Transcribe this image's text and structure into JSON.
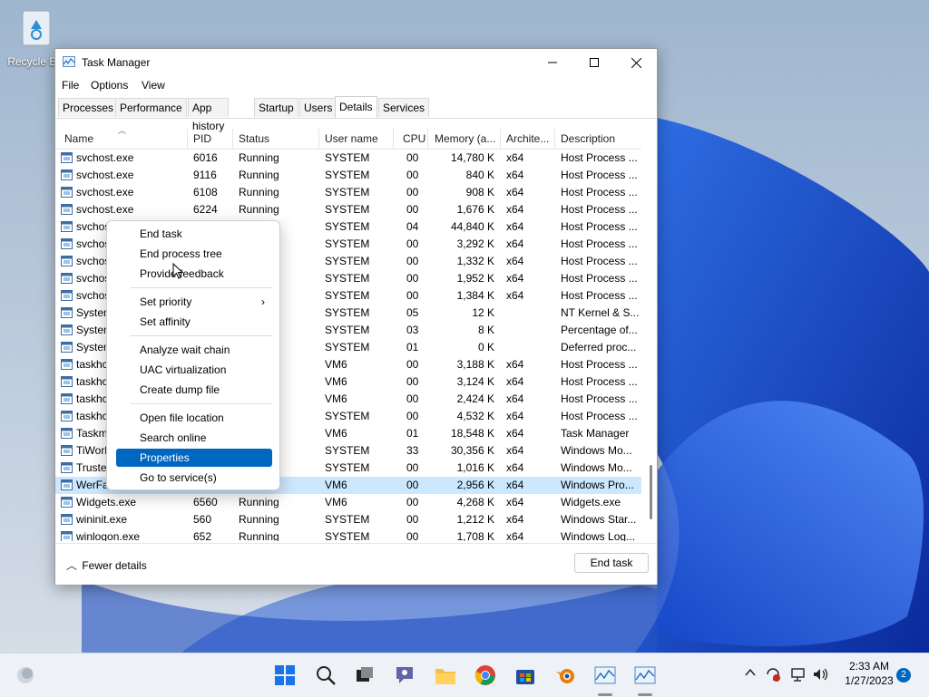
{
  "desktop": {
    "recycle_bin_label": "Recycle Bin"
  },
  "window": {
    "title": "Task Manager",
    "menu": [
      "File",
      "Options",
      "View"
    ],
    "tabs": [
      "Processes",
      "Performance",
      "App history",
      "Startup",
      "Users",
      "Details",
      "Services"
    ],
    "active_tab": "Details",
    "columns": [
      "Name",
      "PID",
      "Status",
      "User name",
      "CPU",
      "Memory (a...",
      "Archite...",
      "Description"
    ],
    "rows": [
      {
        "name": "svchost.exe",
        "pid": "6016",
        "status": "Running",
        "user": "SYSTEM",
        "cpu": "00",
        "mem": "14,780 K",
        "arch": "x64",
        "desc": "Host Process ..."
      },
      {
        "name": "svchost.exe",
        "pid": "9116",
        "status": "Running",
        "user": "SYSTEM",
        "cpu": "00",
        "mem": "840 K",
        "arch": "x64",
        "desc": "Host Process ..."
      },
      {
        "name": "svchost.exe",
        "pid": "6108",
        "status": "Running",
        "user": "SYSTEM",
        "cpu": "00",
        "mem": "908 K",
        "arch": "x64",
        "desc": "Host Process ..."
      },
      {
        "name": "svchost.exe",
        "pid": "6224",
        "status": "Running",
        "user": "SYSTEM",
        "cpu": "00",
        "mem": "1,676 K",
        "arch": "x64",
        "desc": "Host Process ..."
      },
      {
        "name": "svchos",
        "pid": "",
        "status": "",
        "user": "SYSTEM",
        "cpu": "04",
        "mem": "44,840 K",
        "arch": "x64",
        "desc": "Host Process ..."
      },
      {
        "name": "svchos",
        "pid": "",
        "status": "",
        "user": "SYSTEM",
        "cpu": "00",
        "mem": "3,292 K",
        "arch": "x64",
        "desc": "Host Process ..."
      },
      {
        "name": "svchos",
        "pid": "",
        "status": "",
        "user": "SYSTEM",
        "cpu": "00",
        "mem": "1,332 K",
        "arch": "x64",
        "desc": "Host Process ..."
      },
      {
        "name": "svchos",
        "pid": "",
        "status": "",
        "user": "SYSTEM",
        "cpu": "00",
        "mem": "1,952 K",
        "arch": "x64",
        "desc": "Host Process ..."
      },
      {
        "name": "svchos",
        "pid": "",
        "status": "",
        "user": "SYSTEM",
        "cpu": "00",
        "mem": "1,384 K",
        "arch": "x64",
        "desc": "Host Process ..."
      },
      {
        "name": "System",
        "pid": "",
        "status": "",
        "user": "SYSTEM",
        "cpu": "05",
        "mem": "12 K",
        "arch": "",
        "desc": "NT Kernel & S..."
      },
      {
        "name": "System",
        "pid": "",
        "status": "",
        "user": "SYSTEM",
        "cpu": "03",
        "mem": "8 K",
        "arch": "",
        "desc": "Percentage of..."
      },
      {
        "name": "System",
        "pid": "",
        "status": "",
        "user": "SYSTEM",
        "cpu": "01",
        "mem": "0 K",
        "arch": "",
        "desc": "Deferred proc..."
      },
      {
        "name": "taskhc",
        "pid": "",
        "status": "",
        "user": "VM6",
        "cpu": "00",
        "mem": "3,188 K",
        "arch": "x64",
        "desc": "Host Process ..."
      },
      {
        "name": "taskhc",
        "pid": "",
        "status": "",
        "user": "VM6",
        "cpu": "00",
        "mem": "3,124 K",
        "arch": "x64",
        "desc": "Host Process ..."
      },
      {
        "name": "taskhc",
        "pid": "",
        "status": "",
        "user": "VM6",
        "cpu": "00",
        "mem": "2,424 K",
        "arch": "x64",
        "desc": "Host Process ..."
      },
      {
        "name": "taskhc",
        "pid": "",
        "status": "",
        "user": "SYSTEM",
        "cpu": "00",
        "mem": "4,532 K",
        "arch": "x64",
        "desc": "Host Process ..."
      },
      {
        "name": "Taskm",
        "pid": "",
        "status": "",
        "user": "VM6",
        "cpu": "01",
        "mem": "18,548 K",
        "arch": "x64",
        "desc": "Task Manager"
      },
      {
        "name": "TiWorl",
        "pid": "",
        "status": "",
        "user": "SYSTEM",
        "cpu": "33",
        "mem": "30,356 K",
        "arch": "x64",
        "desc": "Windows Mo..."
      },
      {
        "name": "Truste",
        "pid": "",
        "status": "",
        "user": "SYSTEM",
        "cpu": "00",
        "mem": "1,016 K",
        "arch": "x64",
        "desc": "Windows Mo..."
      },
      {
        "name": "WerFa",
        "pid": "",
        "status": "",
        "user": "VM6",
        "cpu": "00",
        "mem": "2,956 K",
        "arch": "x64",
        "desc": "Windows Pro..."
      },
      {
        "name": "Widgets.exe",
        "pid": "6560",
        "status": "Running",
        "user": "VM6",
        "cpu": "00",
        "mem": "4,268 K",
        "arch": "x64",
        "desc": "Widgets.exe"
      },
      {
        "name": "wininit.exe",
        "pid": "560",
        "status": "Running",
        "user": "SYSTEM",
        "cpu": "00",
        "mem": "1,212 K",
        "arch": "x64",
        "desc": "Windows Star..."
      },
      {
        "name": "winlogon.exe",
        "pid": "652",
        "status": "Running",
        "user": "SYSTEM",
        "cpu": "00",
        "mem": "1,708 K",
        "arch": "x64",
        "desc": "Windows Log..."
      }
    ],
    "selected_row_index": 19,
    "fewer_details_label": "Fewer details",
    "end_task_label": "End task"
  },
  "context_menu": {
    "items": [
      {
        "label": "End task"
      },
      {
        "label": "End process tree"
      },
      {
        "label": "Provide feedback"
      },
      {
        "label": "Set priority",
        "submenu": true
      },
      {
        "label": "Set affinity"
      },
      {
        "label": "Analyze wait chain"
      },
      {
        "label": "UAC virtualization"
      },
      {
        "label": "Create dump file"
      },
      {
        "label": "Open file location"
      },
      {
        "label": "Search online"
      },
      {
        "label": "Properties",
        "highlighted": true
      },
      {
        "label": "Go to service(s)"
      }
    ]
  },
  "taskbar": {
    "apps": [
      "start-icon",
      "search-icon",
      "task-view-icon",
      "chat-icon",
      "file-explorer-icon",
      "chrome-icon",
      "store-icon",
      "blender-icon",
      "task-manager-icon",
      "task-manager-icon-2"
    ],
    "time": "2:33 AM",
    "date": "1/27/2023",
    "notification_count": "2"
  },
  "colors": {
    "accent": "#0067c0",
    "selection": "#cce8ff"
  }
}
